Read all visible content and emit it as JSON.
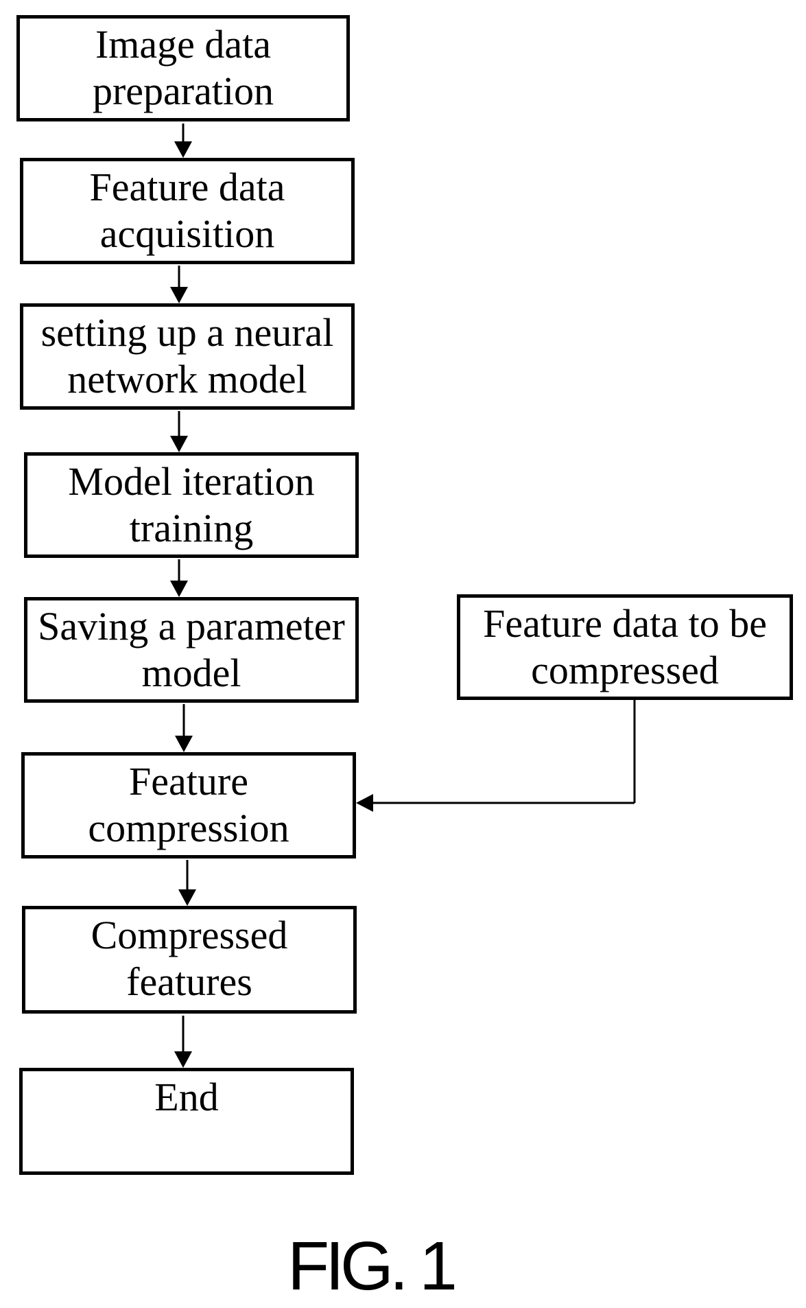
{
  "figure": {
    "label": "FIG. 1",
    "line_color": "#000000",
    "background": "#ffffff"
  },
  "steps": [
    {
      "id": "image-data-preparation",
      "lines": [
        "Image data",
        "preparation"
      ]
    },
    {
      "id": "feature-data-acquisition",
      "lines": [
        "Feature data",
        "acquisition"
      ]
    },
    {
      "id": "setting-up-neural-network-model",
      "lines": [
        "setting up a neural",
        "network model"
      ]
    },
    {
      "id": "model-iteration-training",
      "lines": [
        "Model iteration",
        "training"
      ]
    },
    {
      "id": "saving-parameter-model",
      "lines": [
        "Saving a parameter",
        "model"
      ]
    },
    {
      "id": "feature-compression",
      "lines": [
        "Feature",
        "compression"
      ]
    },
    {
      "id": "compressed-features",
      "lines": [
        "Compressed",
        "features"
      ]
    },
    {
      "id": "end",
      "lines": [
        "End"
      ]
    }
  ],
  "side_input": {
    "id": "feature-data-to-be-compressed",
    "lines": [
      "Feature data to be",
      "compressed"
    ],
    "feeds_into": "feature-compression"
  },
  "flow": [
    [
      "image-data-preparation",
      "feature-data-acquisition"
    ],
    [
      "feature-data-acquisition",
      "setting-up-neural-network-model"
    ],
    [
      "setting-up-neural-network-model",
      "model-iteration-training"
    ],
    [
      "model-iteration-training",
      "saving-parameter-model"
    ],
    [
      "saving-parameter-model",
      "feature-compression"
    ],
    [
      "feature-data-to-be-compressed",
      "feature-compression"
    ],
    [
      "feature-compression",
      "compressed-features"
    ],
    [
      "compressed-features",
      "end"
    ]
  ]
}
